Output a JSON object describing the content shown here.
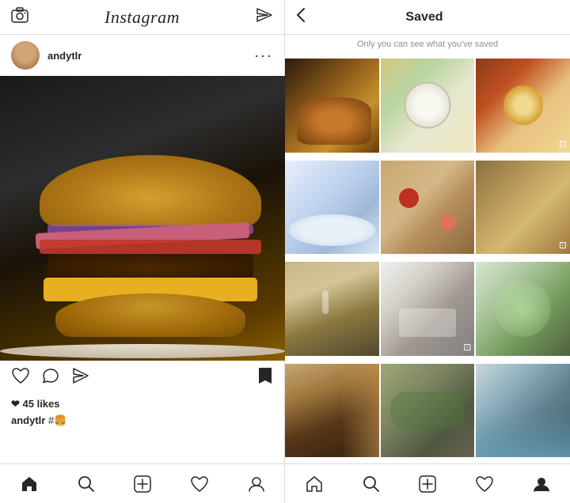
{
  "left": {
    "header": {
      "logo": "Instagram",
      "camera_icon": "📷",
      "send_icon": "✉"
    },
    "user": {
      "username": "andytlr",
      "avatar_alt": "User avatar"
    },
    "post": {
      "image_alt": "Burger photo",
      "likes": "❤ 45 likes",
      "caption_user": "andytlr",
      "caption_text": " #🍔"
    },
    "nav": {
      "home": "home",
      "search": "search",
      "add": "add",
      "heart": "heart",
      "profile": "profile"
    }
  },
  "right": {
    "header": {
      "back": "‹",
      "title": "Saved",
      "subtitle": "Only you can see what you've saved"
    },
    "grid": {
      "items": [
        {
          "id": 1,
          "alt": "Burger close-up",
          "class": "g1"
        },
        {
          "id": 2,
          "alt": "Eggs on plate",
          "class": "g2"
        },
        {
          "id": 3,
          "alt": "Colorful food bowl",
          "class": "g3"
        },
        {
          "id": 4,
          "alt": "Porridge bowl with chopsticks",
          "class": "g4"
        },
        {
          "id": 5,
          "alt": "Strawberries on wooden plate",
          "class": "g5"
        },
        {
          "id": 6,
          "alt": "Autumn lake landscape",
          "class": "g6"
        },
        {
          "id": 7,
          "alt": "Desert landscape with hiker",
          "class": "g7"
        },
        {
          "id": 8,
          "alt": "Victorian house",
          "class": "g8"
        },
        {
          "id": 9,
          "alt": "Blossom tree",
          "class": "g9"
        },
        {
          "id": 10,
          "alt": "Antelope Canyon",
          "class": "g10"
        },
        {
          "id": 11,
          "alt": "Cattle on field",
          "class": "g11"
        },
        {
          "id": 12,
          "alt": "Crystal clear water",
          "class": "g12"
        }
      ]
    },
    "nav": {
      "home": "home",
      "search": "search",
      "add": "add",
      "heart": "heart",
      "profile": "profile"
    }
  }
}
